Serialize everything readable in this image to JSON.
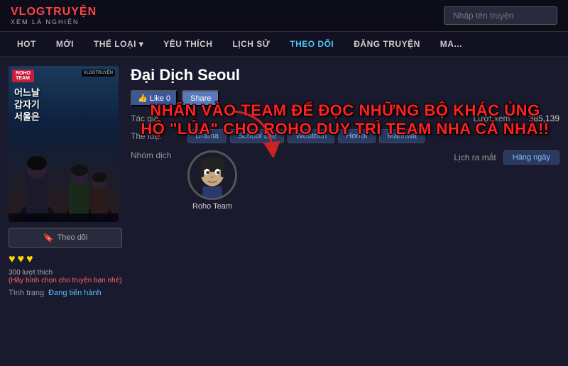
{
  "site": {
    "logo": "VLOGTRUYỆN",
    "tagline": "XEM LÀ NGHIỆN",
    "search_placeholder": "Nhập tên truyện"
  },
  "nav": {
    "items": [
      {
        "id": "hot",
        "label": "HOT"
      },
      {
        "id": "moi",
        "label": "MỚI"
      },
      {
        "id": "the-loai",
        "label": "THỂ LOẠI ▾"
      },
      {
        "id": "yeu-thich",
        "label": "YÊU THÍCH"
      },
      {
        "id": "lich-su",
        "label": "LỊCH SỬ"
      },
      {
        "id": "theo-doi",
        "label": "THEO DÕI"
      },
      {
        "id": "dang-truyen",
        "label": "ĐĂNG TRUYỆN"
      },
      {
        "id": "ma",
        "label": "MA..."
      }
    ]
  },
  "cover": {
    "roho_badge": "ROHO\nTEAM",
    "vlog_badge": "VLOGTRUYỆN",
    "text_line1": "어느날",
    "text_line2": "갑자기",
    "text_line3": "서울은"
  },
  "manga": {
    "title": "Đại Dịch Seoul",
    "overlay_line1": "NHẤN VÀO TEAM ĐỂ ĐỌC NHỮNG BỘ KHÁC ỦNG",
    "overlay_line2": "HỘ \"LÚA\" CHO ROHO DUY TRÌ TEAM NHA CẢ NHÀ!!",
    "like_label": "Like 0",
    "share_label": "Share",
    "tac_gia_label": "Tác giả",
    "the_loai_label": "Thể loại",
    "nhom_dich_label": "Nhóm dịch",
    "luot_xem_label": "Lượt xem",
    "luot_xem_value": "385,139",
    "lich_ra_mat_label": "Lịch ra mắt",
    "lich_ra_mat_value": "Hàng ngày",
    "tags": [
      "Drama",
      "School Life",
      "Webtoon",
      "Horror",
      "Manhwa"
    ],
    "translator": "Roho Team",
    "follow_label": "Theo dõi",
    "hearts": [
      "♥",
      "♥",
      "♥"
    ],
    "likes_count": "300 lượt thích",
    "likes_cta": "(Hãy bình chọn cho truyện bạn nhé)",
    "status_label": "Tình trạng",
    "status_value": "Đang tiến hành"
  }
}
